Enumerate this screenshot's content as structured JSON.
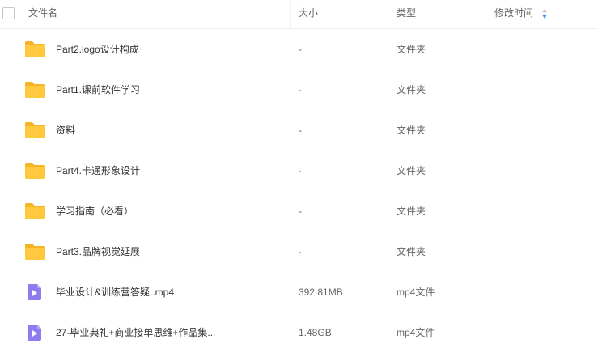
{
  "header": {
    "name": "文件名",
    "size": "大小",
    "type": "类型",
    "modified": "修改时间"
  },
  "colors": {
    "folder": "#FFC83D",
    "folder_tab": "#F5B325",
    "video": "#8C7CF0",
    "sort_active": "#3B8CFF"
  },
  "files": [
    {
      "name": "Part2.logo设计构成",
      "size": "-",
      "type": "文件夹",
      "icon": "folder-icon"
    },
    {
      "name": "Part1.课前软件学习",
      "size": "-",
      "type": "文件夹",
      "icon": "folder-icon"
    },
    {
      "name": "资料",
      "size": "-",
      "type": "文件夹",
      "icon": "folder-icon"
    },
    {
      "name": "Part4.卡通形象设计",
      "size": "-",
      "type": "文件夹",
      "icon": "folder-icon"
    },
    {
      "name": "学习指南（必看）",
      "size": "-",
      "type": "文件夹",
      "icon": "folder-icon"
    },
    {
      "name": "Part3.品牌视觉延展",
      "size": "-",
      "type": "文件夹",
      "icon": "folder-icon"
    },
    {
      "name": "毕业设计&训练营答疑 .mp4",
      "size": "392.81MB",
      "type": "mp4文件",
      "icon": "video-file-icon"
    },
    {
      "name": "27-毕业典礼+商业接单思维+作品集...",
      "size": "1.48GB",
      "type": "mp4文件",
      "icon": "video-file-icon"
    }
  ]
}
